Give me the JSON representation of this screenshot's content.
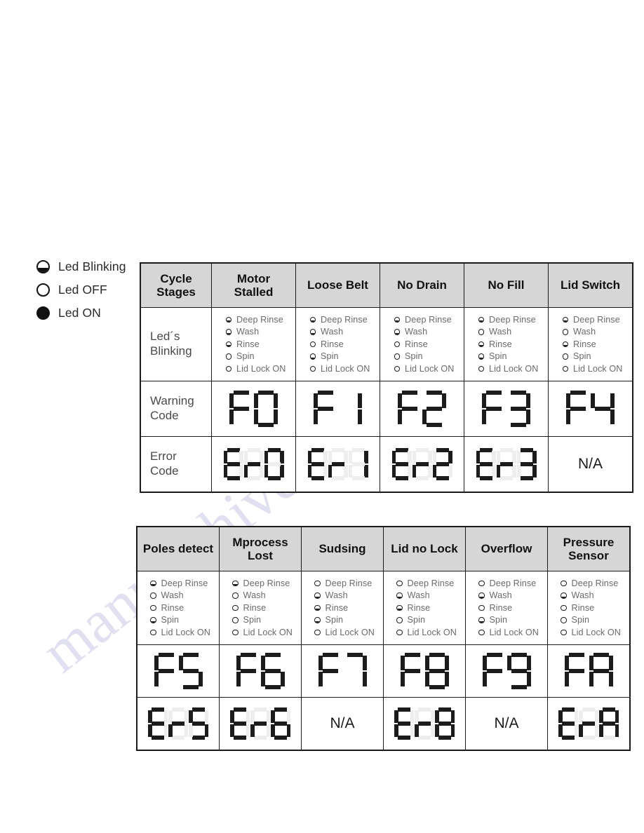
{
  "legend": {
    "items": [
      {
        "state": "blink",
        "label": "Led Blinking",
        "icon": "led-blinking-icon"
      },
      {
        "state": "off",
        "label": "Led OFF",
        "icon": "led-off-icon"
      },
      {
        "state": "on",
        "label": "Led ON",
        "icon": "led-on-icon"
      }
    ]
  },
  "watermark": {
    "text": "manualshive.com"
  },
  "stage_names": [
    "Deep Rinse",
    "Wash",
    "Rinse",
    "Spin",
    "Lid Lock ON"
  ],
  "row_labels": {
    "leds": "Led´s\nBlinking",
    "leds_line1": "Led´s",
    "leds_line2": "Blinking",
    "warning_line1": "Warning",
    "warning_line2": "Code",
    "error_line1": "Error",
    "error_line2": "Code"
  },
  "table1": {
    "first_header_line1": "Cycle",
    "first_header_line2": "Stages",
    "columns": [
      {
        "header_line1": "Motor",
        "header_line2": "Stalled",
        "header": "Motor Stalled",
        "leds": [
          "blink",
          "blink",
          "blink",
          "off",
          "off"
        ],
        "warning_code": "F0",
        "warning_digits": [
          "F",
          "0"
        ],
        "error_code": "Er0",
        "error_digits": [
          "E",
          "r",
          "0"
        ]
      },
      {
        "header_line1": "Loose Belt",
        "header_line2": "",
        "header": "Loose Belt",
        "leds": [
          "blink",
          "blink",
          "off",
          "blink",
          "off"
        ],
        "warning_code": "F1",
        "warning_digits": [
          "F",
          "1"
        ],
        "error_code": "Er1",
        "error_digits": [
          "E",
          "r",
          "1"
        ]
      },
      {
        "header_line1": "No Drain",
        "header_line2": "",
        "header": "No Drain",
        "leds": [
          "blink",
          "blink",
          "off",
          "off",
          "off"
        ],
        "warning_code": "F2",
        "warning_digits": [
          "F",
          "2"
        ],
        "error_code": "Er2",
        "error_digits": [
          "E",
          "r",
          "2"
        ]
      },
      {
        "header_line1": "No Fill",
        "header_line2": "",
        "header": "No Fill",
        "leds": [
          "blink",
          "off",
          "blink",
          "blink",
          "off"
        ],
        "warning_code": "F3",
        "warning_digits": [
          "F",
          "3"
        ],
        "error_code": "Er3",
        "error_digits": [
          "E",
          "r",
          "3"
        ]
      },
      {
        "header_line1": "Lid Switch",
        "header_line2": "",
        "header": "Lid Switch",
        "leds": [
          "blink",
          "off",
          "blink",
          "off",
          "off"
        ],
        "warning_code": "F4",
        "warning_digits": [
          "F",
          "4"
        ],
        "error_code": "N/A",
        "error_digits": null
      }
    ]
  },
  "table2": {
    "columns": [
      {
        "header_line1": "Poles detect",
        "header_line2": "",
        "header": "Poles detect",
        "leds": [
          "blink",
          "off",
          "off",
          "blink",
          "off"
        ],
        "warning_code": "F5",
        "warning_digits": [
          "F",
          "5"
        ],
        "error_code": "Er5",
        "error_digits": [
          "E",
          "r",
          "5"
        ]
      },
      {
        "header_line1": "Mprocess",
        "header_line2": "Lost",
        "header": "Mprocess Lost",
        "leds": [
          "blink",
          "off",
          "off",
          "off",
          "off"
        ],
        "warning_code": "F6",
        "warning_digits": [
          "F",
          "6"
        ],
        "error_code": "Er6",
        "error_digits": [
          "E",
          "r",
          "6"
        ]
      },
      {
        "header_line1": "Sudsing",
        "header_line2": "",
        "header": "Sudsing",
        "leds": [
          "off",
          "blink",
          "blink",
          "blink",
          "off"
        ],
        "warning_code": "F7",
        "warning_digits": [
          "F",
          "7"
        ],
        "error_code": "N/A",
        "error_digits": null
      },
      {
        "header_line1": "Lid no Lock",
        "header_line2": "",
        "header": "Lid no Lock",
        "leds": [
          "off",
          "blink",
          "blink",
          "off",
          "off"
        ],
        "warning_code": "F8",
        "warning_digits": [
          "F",
          "8"
        ],
        "error_code": "Er8",
        "error_digits": [
          "E",
          "r",
          "8"
        ]
      },
      {
        "header_line1": "Overflow",
        "header_line2": "",
        "header": "Overflow",
        "leds": [
          "off",
          "blink",
          "off",
          "blink",
          "off"
        ],
        "warning_code": "F9",
        "warning_digits": [
          "F",
          "9"
        ],
        "error_code": "N/A",
        "error_digits": null
      },
      {
        "header_line1": "Pressure",
        "header_line2": "Sensor",
        "header": "Pressure Sensor",
        "leds": [
          "off",
          "blink",
          "off",
          "off",
          "off"
        ],
        "warning_code": "FA",
        "warning_digits": [
          "F",
          "A"
        ],
        "error_code": "ErA",
        "error_digits": [
          "E",
          "r",
          "A"
        ]
      }
    ]
  }
}
